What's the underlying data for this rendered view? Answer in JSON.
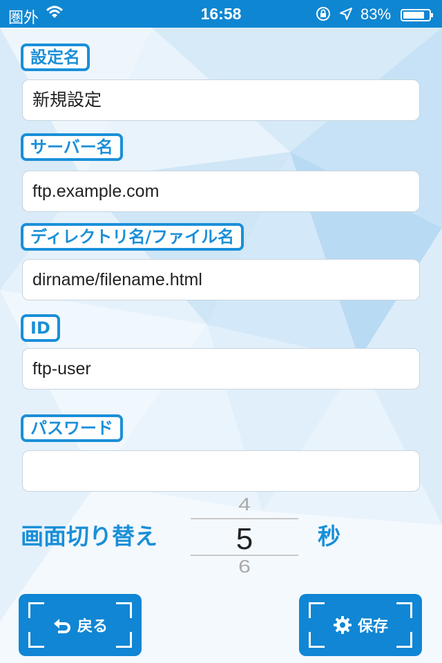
{
  "status_bar": {
    "carrier": "圏外",
    "time": "16:58",
    "battery_percent": "83%",
    "battery_level": 0.83,
    "icons": [
      "wifi-icon",
      "orientation-lock-icon",
      "location-arrow-icon",
      "battery-icon"
    ]
  },
  "form": {
    "setting_name": {
      "label": "設定名",
      "value": "新規設定"
    },
    "server_name": {
      "label": "サーバー名",
      "value": "ftp.example.com"
    },
    "path": {
      "label": "ディレクトリ名/ファイル名",
      "value": "dirname/filename.html"
    },
    "user_id": {
      "label": "ID",
      "value": "ftp-user"
    },
    "password": {
      "label": "パスワード",
      "value": ""
    }
  },
  "screen_switch": {
    "label": "画面切り替え",
    "picker": {
      "prev": "4",
      "selected": "5",
      "next": "6"
    },
    "unit": "秒"
  },
  "buttons": {
    "back": {
      "label": "戻る",
      "icon": "back-arrow-icon"
    },
    "save": {
      "label": "保存",
      "icon": "gear-icon"
    }
  },
  "colors": {
    "accent": "#1a8fd8",
    "status_bar": "#0f86d2",
    "button": "#1086d4"
  }
}
